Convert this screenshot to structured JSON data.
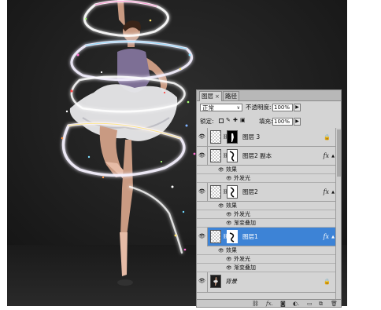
{
  "panel": {
    "tabs": [
      {
        "label": "图层",
        "close": "×"
      },
      {
        "label": "路径"
      }
    ],
    "blend_mode": "正常",
    "opacity_label": "不透明度:",
    "opacity_value": "100%",
    "lock_label": "锁定:",
    "fill_label": "填充:",
    "fill_value": "100%",
    "layers": [
      {
        "name": "图层 3"
      },
      {
        "name": "图层2 副本",
        "fx": "fx",
        "effects_label": "效果",
        "effects": [
          "外发光"
        ]
      },
      {
        "name": "图层2",
        "fx": "fx",
        "effects_label": "效果",
        "effects": [
          "外发光",
          "渐变叠加"
        ]
      },
      {
        "name": "图层1",
        "selected": true,
        "fx": "fx",
        "effects_label": "效果",
        "effects": [
          "外发光",
          "渐变叠加"
        ]
      },
      {
        "name": "背景"
      }
    ],
    "bottom_icons": [
      "link-icon",
      "fx-icon",
      "mask-icon",
      "adjustment-icon",
      "group-icon",
      "new-layer-icon",
      "trash-icon"
    ]
  },
  "colors": {
    "selection": "#3d83d6",
    "panel_bg": "#d4d4d4",
    "photo_bg": "#1f1f1f"
  }
}
